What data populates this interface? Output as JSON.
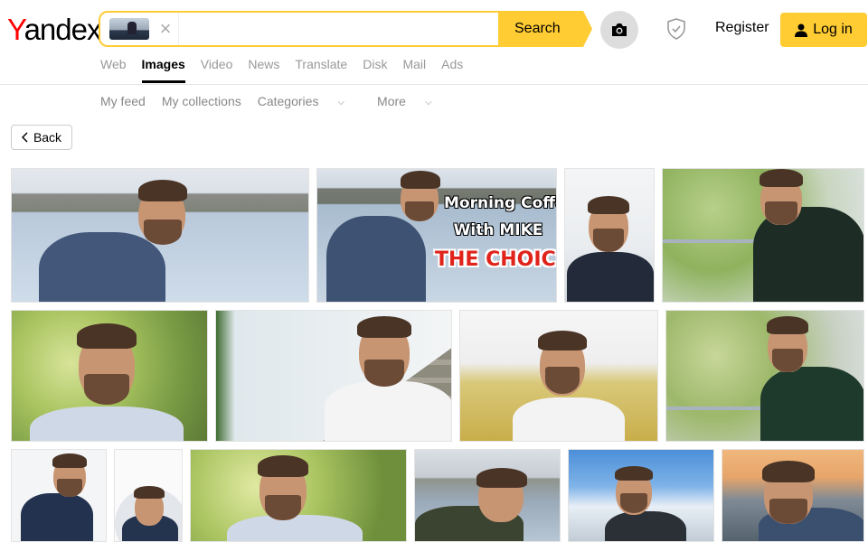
{
  "logo": {
    "first_letter": "Y",
    "rest": "andex"
  },
  "search": {
    "value": "",
    "placeholder": "",
    "button_label": "Search"
  },
  "header": {
    "register_label": "Register",
    "login_label": "Log in"
  },
  "services": [
    "Web",
    "Images",
    "Video",
    "News",
    "Translate",
    "Disk",
    "Mail",
    "Ads"
  ],
  "subnav": {
    "my_feed": "My feed",
    "my_collections": "My collections",
    "categories": "Categories",
    "more": "More"
  },
  "back_label": "Back",
  "overlay": {
    "line1": "Morning Coffee",
    "line2": "With MIKE",
    "line3": "THE CHOICE"
  },
  "colors": {
    "accent": "#ffcc33",
    "logo_red": "#ff0000"
  }
}
